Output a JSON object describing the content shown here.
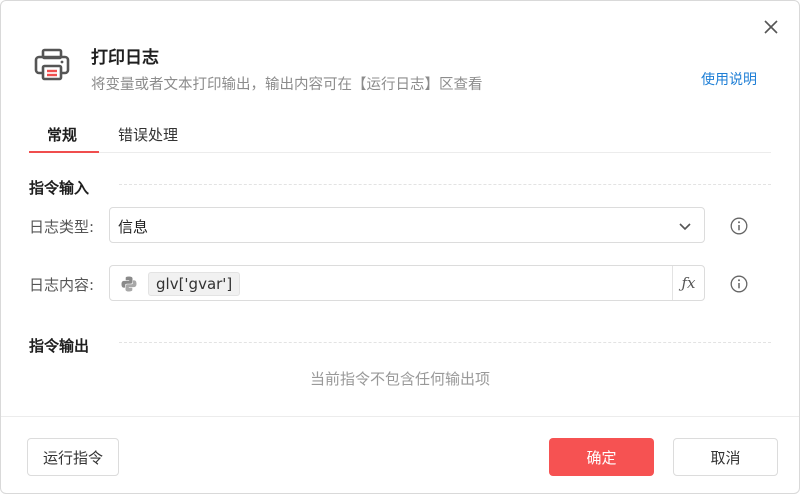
{
  "dialog": {
    "title": "打印日志",
    "subtitle": "将变量或者文本打印输出，输出内容可在【运行日志】区查看",
    "help_link": "使用说明"
  },
  "tabs": [
    {
      "label": "常规",
      "active": true
    },
    {
      "label": "错误处理",
      "active": false
    }
  ],
  "input_section": {
    "title": "指令输入",
    "log_type": {
      "label": "日志类型:",
      "value": "信息"
    },
    "log_content": {
      "label": "日志内容:",
      "value": "glv['gvar']"
    }
  },
  "output_section": {
    "title": "指令输出",
    "empty_note": "当前指令不包含任何输出项"
  },
  "footer": {
    "run_label": "运行指令",
    "ok_label": "确定",
    "cancel_label": "取消"
  },
  "colors": {
    "accent": "#f65252",
    "link": "#1f7fd6"
  }
}
